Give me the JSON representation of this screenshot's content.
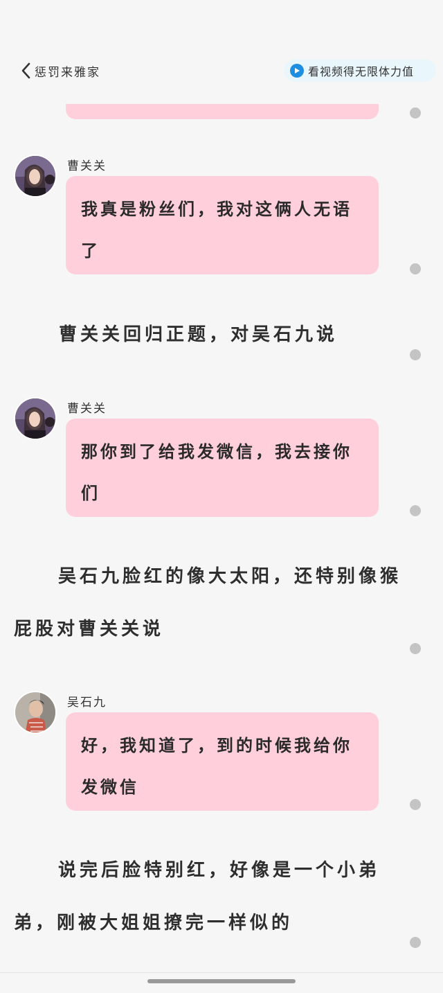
{
  "header": {
    "back_title": "惩罚来雅家",
    "promo_text": "看视频得无限体力值",
    "promo_color": "#1e8fe0"
  },
  "messages": [
    {
      "speaker": "曹关关",
      "text": "我真是粉丝们，我对这俩人无语了"
    },
    {
      "speaker": "曹关关",
      "text": "那你到了给我发微信，我去接你们"
    },
    {
      "speaker": "吴石九",
      "text": "好，我知道了，到的时候我给你发微信"
    }
  ],
  "narrations": [
    "曹关关回归正题，对吴石九说",
    "吴石九脸红的像大太阳，还特别像猴屁股对曹关关说",
    "说完后脸特别红，好像是一个小弟弟，刚被大姐姐撩完一样似的"
  ],
  "colors": {
    "bubble": "#ffcfdb",
    "background": "#f6f6f6"
  }
}
